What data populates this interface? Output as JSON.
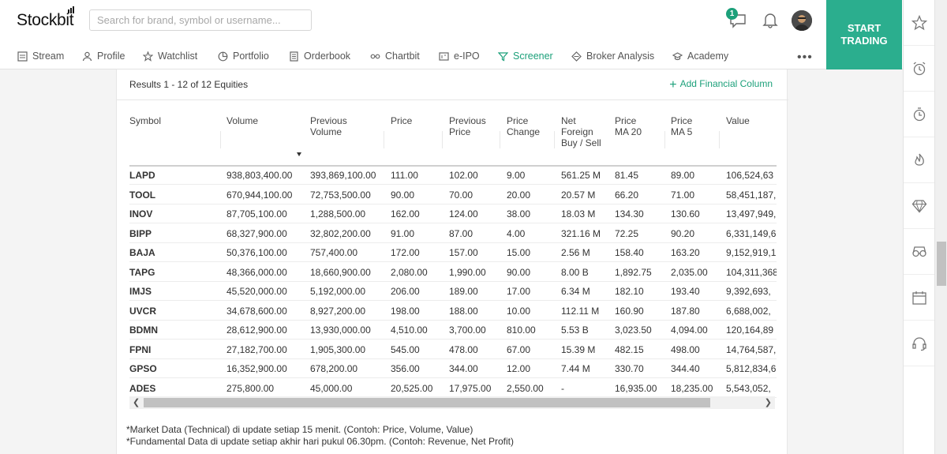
{
  "header": {
    "logo": "Stockbit",
    "search_placeholder": "Search for brand, symbol or username...",
    "message_badge": "1",
    "start_trading": "START TRADING"
  },
  "nav": [
    {
      "label": "Stream",
      "icon": "stream-icon"
    },
    {
      "label": "Profile",
      "icon": "user-icon"
    },
    {
      "label": "Watchlist",
      "icon": "star-icon"
    },
    {
      "label": "Portfolio",
      "icon": "pie-icon"
    },
    {
      "label": "Orderbook",
      "icon": "orderbook-icon"
    },
    {
      "label": "Chartbit",
      "icon": "chartbit-icon"
    },
    {
      "label": "e-IPO",
      "icon": "ipo-icon"
    },
    {
      "label": "Screener",
      "icon": "filter-icon",
      "active": true
    },
    {
      "label": "Broker Analysis",
      "icon": "broker-icon"
    },
    {
      "label": "Academy",
      "icon": "academy-icon"
    }
  ],
  "screener": {
    "results": "Results 1 - 12 of 12 Equities",
    "add_column": "Add Financial Column",
    "columns": [
      "Symbol",
      "Volume",
      "Previous Volume",
      "Price",
      "Previous Price",
      "Price Change",
      "Net Foreign Buy / Sell",
      "Price MA 20",
      "Price MA 5",
      "Value"
    ],
    "rows": [
      [
        "LAPD",
        "938,803,400.00",
        "393,869,100.00",
        "111.00",
        "102.00",
        "9.00",
        "561.25 M",
        "81.45",
        "89.00",
        "106,524,63"
      ],
      [
        "TOOL",
        "670,944,100.00",
        "72,753,500.00",
        "90.00",
        "70.00",
        "20.00",
        "20.57 M",
        "66.20",
        "71.00",
        "58,451,187,"
      ],
      [
        "INOV",
        "87,705,100.00",
        "1,288,500.00",
        "162.00",
        "124.00",
        "38.00",
        "18.03 M",
        "134.30",
        "130.60",
        "13,497,949,"
      ],
      [
        "BIPP",
        "68,327,900.00",
        "32,802,200.00",
        "91.00",
        "87.00",
        "4.00",
        "321.16 M",
        "72.25",
        "90.20",
        "6,331,149,6"
      ],
      [
        "BAJA",
        "50,376,100.00",
        "757,400.00",
        "172.00",
        "157.00",
        "15.00",
        "2.56 M",
        "158.40",
        "163.20",
        "9,152,919,1"
      ],
      [
        "TAPG",
        "48,366,000.00",
        "18,660,900.00",
        "2,080.00",
        "1,990.00",
        "90.00",
        "8.00 B",
        "1,892.75",
        "2,035.00",
        "104,311,368"
      ],
      [
        "IMJS",
        "45,520,000.00",
        "5,192,000.00",
        "206.00",
        "189.00",
        "17.00",
        "6.34 M",
        "182.10",
        "193.40",
        "9,392,693,"
      ],
      [
        "UVCR",
        "34,678,600.00",
        "8,927,200.00",
        "198.00",
        "188.00",
        "10.00",
        "112.11 M",
        "160.90",
        "187.80",
        "6,688,002,"
      ],
      [
        "BDMN",
        "28,612,900.00",
        "13,930,000.00",
        "4,510.00",
        "3,700.00",
        "810.00",
        "5.53 B",
        "3,023.50",
        "4,094.00",
        "120,164,89"
      ],
      [
        "FPNI",
        "27,182,700.00",
        "1,905,300.00",
        "545.00",
        "478.00",
        "67.00",
        "15.39 M",
        "482.15",
        "498.00",
        "14,764,587,"
      ],
      [
        "GPSO",
        "16,352,900.00",
        "678,200.00",
        "356.00",
        "344.00",
        "12.00",
        "7.44 M",
        "330.70",
        "344.40",
        "5,812,834,6"
      ],
      [
        "ADES",
        "275,800.00",
        "45,000.00",
        "20,525.00",
        "17,975.00",
        "2,550.00",
        "-",
        "16,935.00",
        "18,235.00",
        "5,543,052,"
      ]
    ],
    "notes": [
      "*Market Data (Technical) di update setiap 15 menit. (Contoh: Price, Volume, Value)",
      "*Fundamental Data di update setiap akhir hari pukul 06.30pm. (Contoh: Revenue, Net Profit)"
    ]
  },
  "rail_icons": [
    "star-icon",
    "alarm-clock-icon",
    "stopwatch-icon",
    "fire-icon",
    "diamond-icon",
    "glasses-icon",
    "calendar-icon",
    "headset-icon"
  ],
  "colors": {
    "accent": "#1ca07a",
    "start_button": "#2bae8e"
  }
}
